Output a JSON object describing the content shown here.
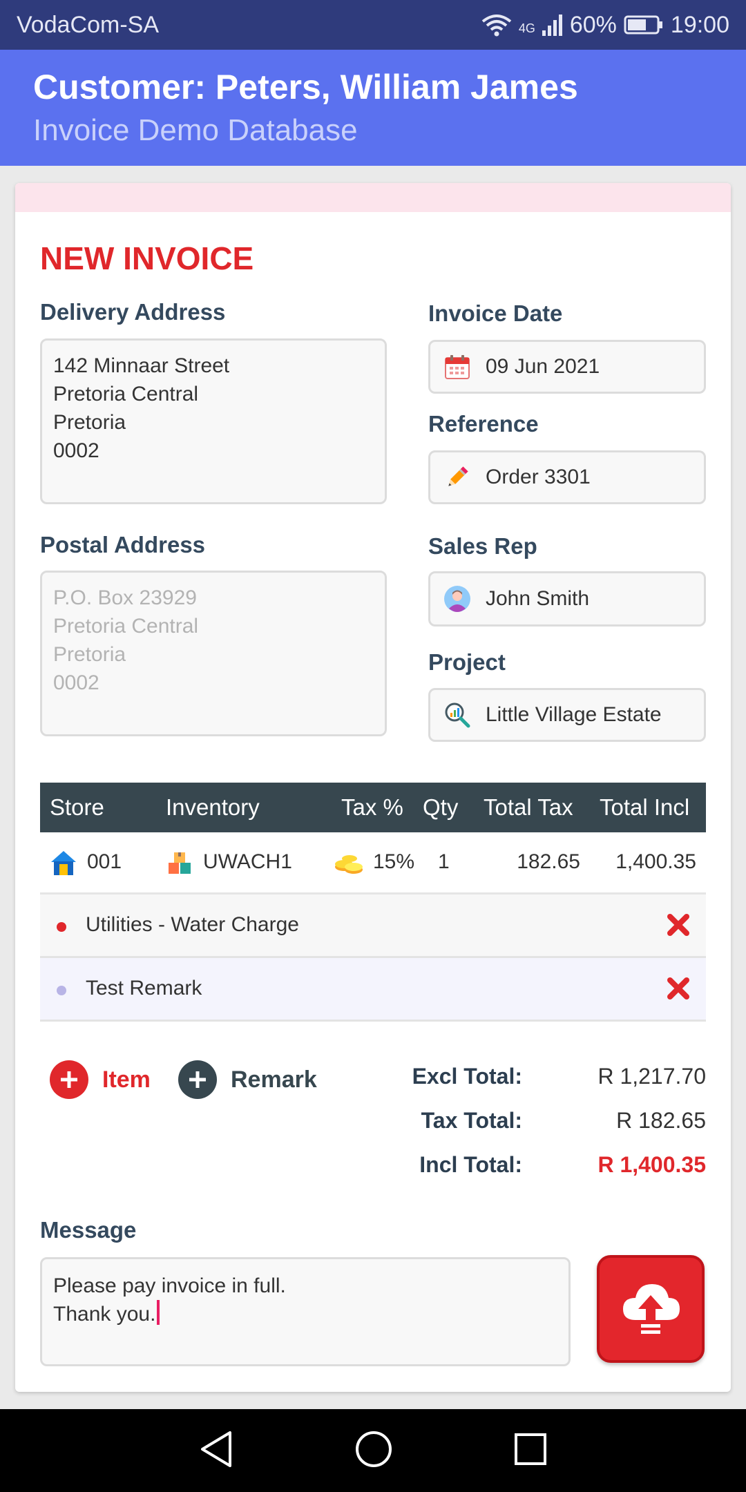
{
  "status_bar": {
    "carrier": "VodaCom-SA",
    "network": "4G",
    "battery": "60%",
    "time": "19:00"
  },
  "header": {
    "title": "Customer: Peters, William James",
    "subtitle": "Invoice Demo Database"
  },
  "invoice": {
    "heading": "NEW INVOICE",
    "delivery_address": {
      "label": "Delivery Address",
      "value": "142 Minnaar Street\nPretoria Central\nPretoria\n0002"
    },
    "postal_address": {
      "label": "Postal Address",
      "placeholder": "P.O. Box 23929\nPretoria Central\nPretoria\n0002"
    },
    "invoice_date": {
      "label": "Invoice Date",
      "value": "09 Jun 2021",
      "icon": "calendar-icon"
    },
    "reference": {
      "label": "Reference",
      "value": "Order 3301",
      "icon": "pencil-icon"
    },
    "sales_rep": {
      "label": "Sales Rep",
      "value": "John Smith",
      "icon": "user-avatar-icon"
    },
    "project": {
      "label": "Project",
      "value": "Little Village Estate",
      "icon": "search-chart-icon"
    }
  },
  "table": {
    "columns": [
      "Store",
      "Inventory",
      "Tax %",
      "Qty",
      "Total Tax",
      "Total Incl"
    ],
    "rows": [
      {
        "store": "001",
        "inventory": "UWACH1",
        "tax": "15%",
        "qty": "1",
        "total_tax": "182.65",
        "total_incl": "1,400.35"
      }
    ],
    "lines": [
      {
        "text": "Utilities - Water Charge",
        "dot_color": "#e0272b"
      },
      {
        "text": "Test Remark",
        "dot_color": "#b8b4e6"
      }
    ]
  },
  "actions": {
    "add_item": "Item",
    "add_remark": "Remark"
  },
  "totals": {
    "excl_label": "Excl Total:",
    "excl_value": "R 1,217.70",
    "tax_label": "Tax Total:",
    "tax_value": "R 182.65",
    "incl_label": "Incl Total:",
    "incl_value": "R 1,400.35"
  },
  "message": {
    "label": "Message",
    "value": "Please pay invoice in full.\nThank you."
  },
  "colors": {
    "status_bar": "#2f3b7c",
    "header": "#5b71ef",
    "accent_red": "#e0272b",
    "table_header": "#37474f"
  }
}
